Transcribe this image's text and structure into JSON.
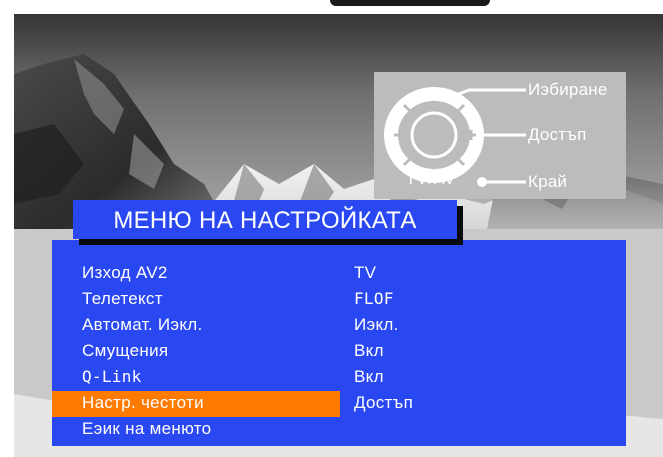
{
  "help": {
    "select": "Иэбиране",
    "access": "Достъп",
    "exit": "Край",
    "tv_av": "TV/AV",
    "icons": [
      "dpad-up-arrow-icon",
      "dpad-down-arrow-icon",
      "minus-icon",
      "plus-icon",
      "tv-av-button-icon"
    ]
  },
  "menu": {
    "title": "МЕНЮ НА НАСТРОЙКАТА",
    "selected_index": 5,
    "items": [
      {
        "label": "Изход AV2",
        "value": "TV"
      },
      {
        "label": "Телетекст",
        "value": "FLOF"
      },
      {
        "label": "Автомат. Иэкл.",
        "value": "Иэкл."
      },
      {
        "label": "Смущения",
        "value": "Вкл"
      },
      {
        "label": "Q-Link",
        "value": "Вкл"
      },
      {
        "label": "Настр. честоти",
        "value": "Достъп"
      },
      {
        "label": "Еэик на менюто",
        "value": ""
      }
    ]
  },
  "colors": {
    "menu_blue": "#2a48f2",
    "highlight_orange": "#ff7a00",
    "help_gray": "#bcbcbc"
  }
}
